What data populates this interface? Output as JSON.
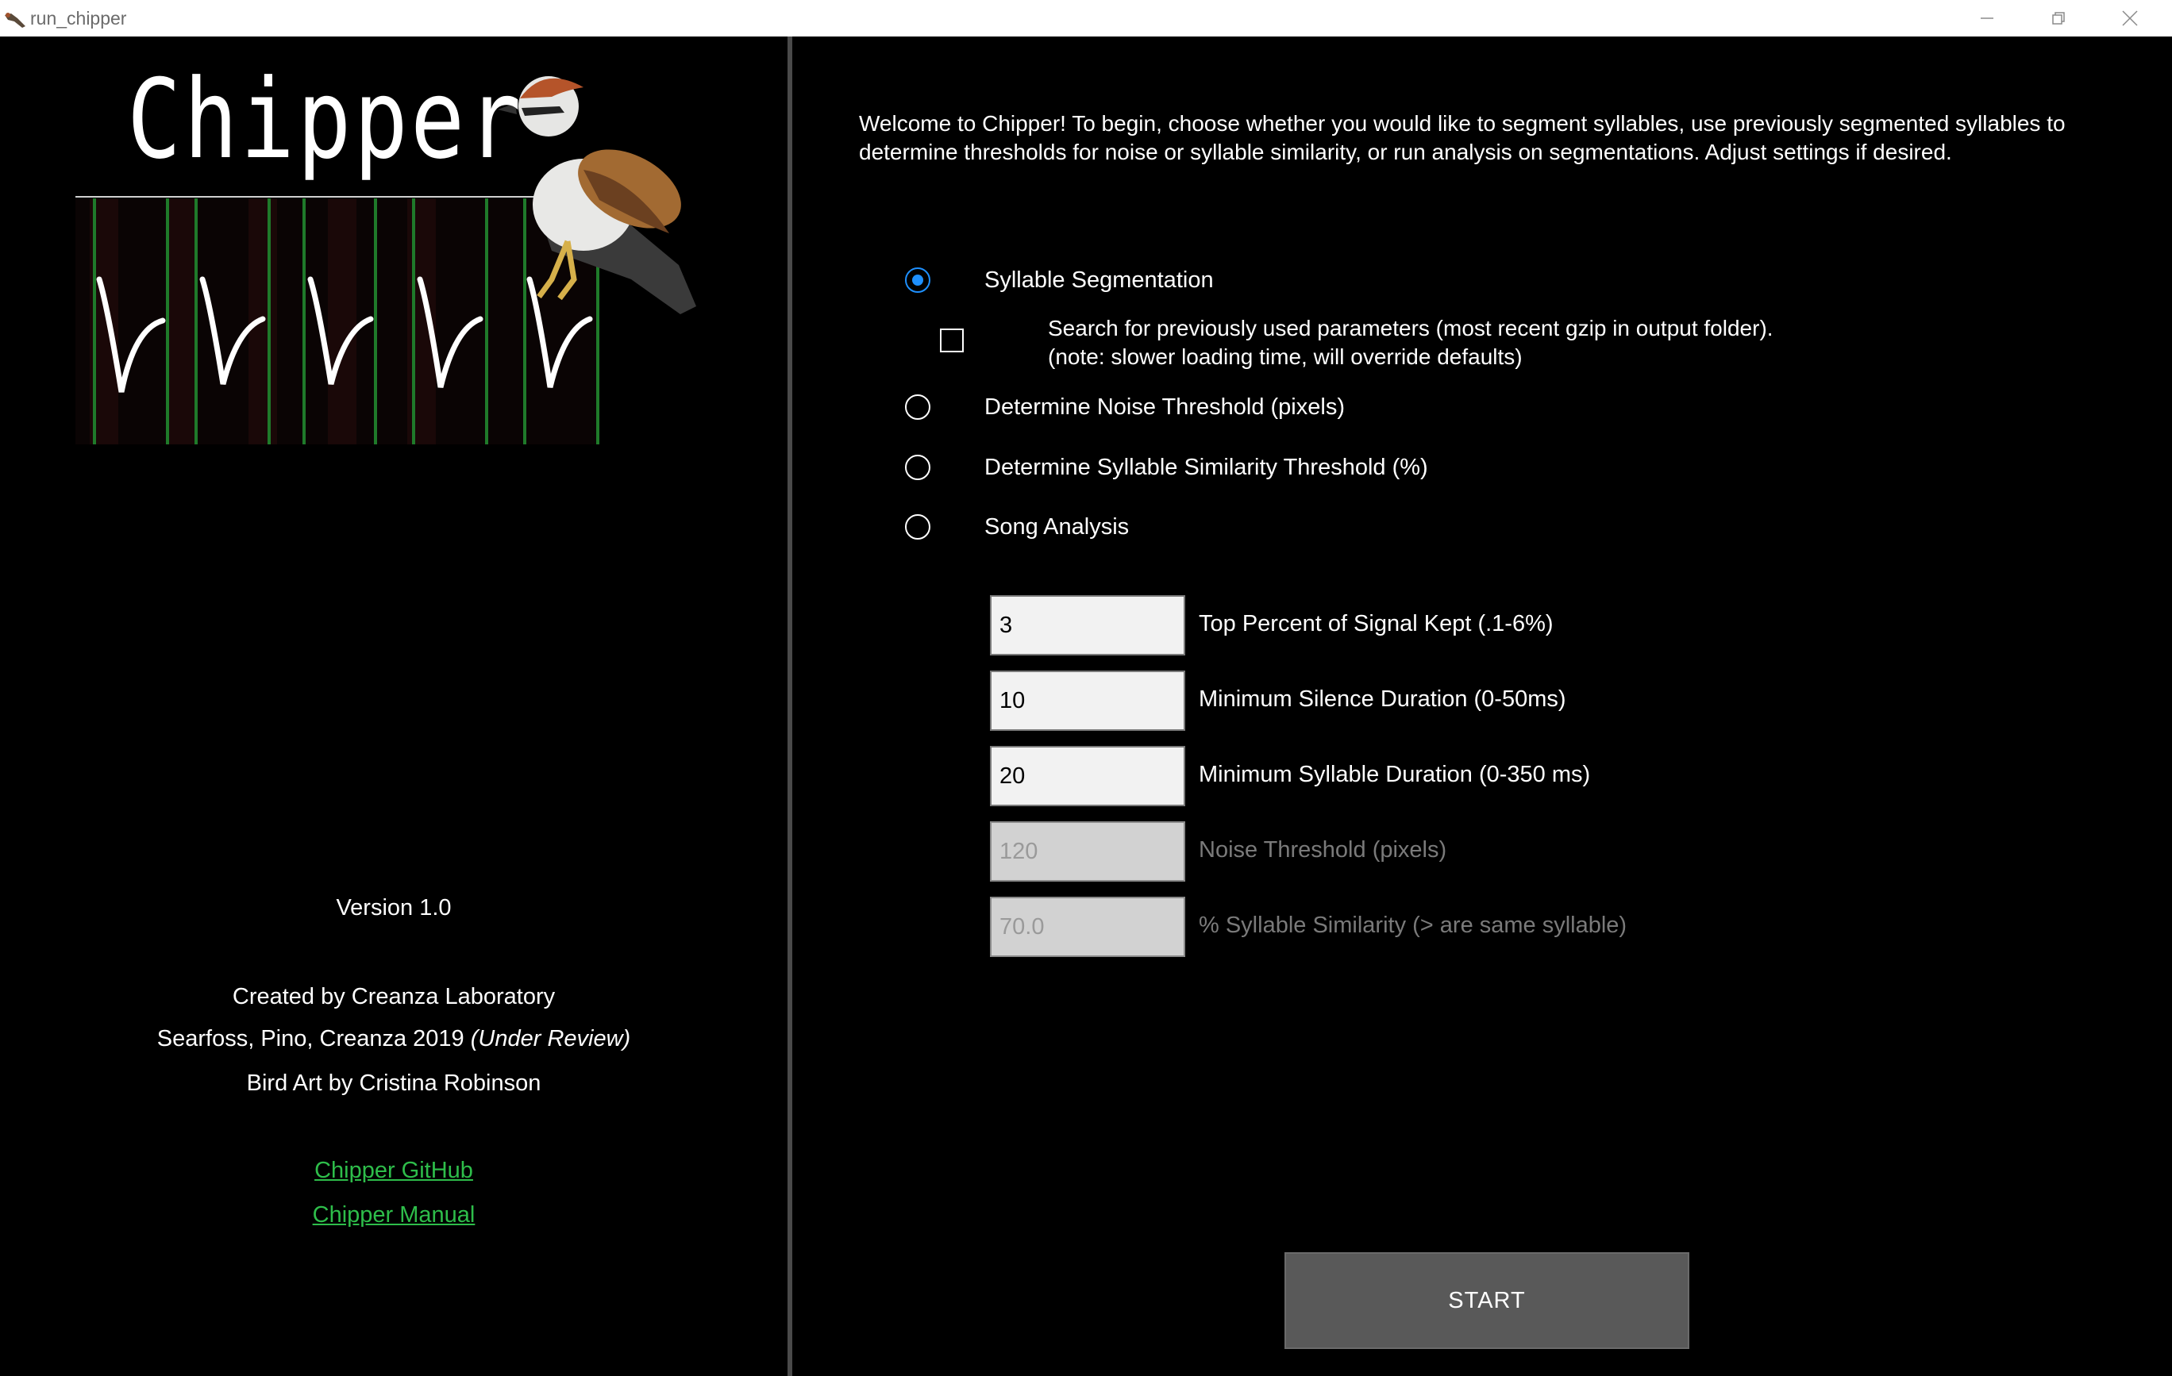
{
  "window": {
    "title": "run_chipper",
    "app_icon": "chipper-bird-icon",
    "controls": [
      "minimize-icon",
      "restore-icon",
      "close-icon"
    ]
  },
  "left": {
    "logo_text": "Chipper",
    "version": "Version 1.0",
    "created_by": "Created by Creanza Laboratory",
    "citation_text": "Searfoss, Pino, Creanza 2019 ",
    "citation_status": "(Under Review)",
    "bird_art": "Bird Art by Cristina Robinson",
    "links": {
      "github": "Chipper GitHub",
      "manual": "Chipper Manual"
    }
  },
  "right": {
    "welcome": "Welcome to Chipper! To begin, choose whether you would like to segment syllables, use previously segmented syllables to determine thresholds for noise or syllable similarity, or run analysis on segmentations. Adjust settings if desired.",
    "modes": [
      {
        "label": "Syllable Segmentation",
        "selected": true
      },
      {
        "label": "Determine Noise Threshold (pixels)",
        "selected": false
      },
      {
        "label": "Determine Syllable Similarity Threshold (%)",
        "selected": false
      },
      {
        "label": "Song Analysis",
        "selected": false
      }
    ],
    "search_params": {
      "checked": false,
      "line1": "Search for previously used parameters (most recent gzip in output folder).",
      "line2": "(note: slower loading time, will override defaults)"
    },
    "params": [
      {
        "value": "3",
        "label": "Top Percent of Signal Kept (.1-6%)",
        "enabled": true
      },
      {
        "value": "10",
        "label": "Minimum Silence Duration (0-50ms)",
        "enabled": true
      },
      {
        "value": "20",
        "label": "Minimum Syllable Duration (0-350 ms)",
        "enabled": true
      },
      {
        "value": "120",
        "label": "Noise Threshold (pixels)",
        "enabled": false
      },
      {
        "value": "70.0",
        "label": "% Syllable Similarity (> are same syllable)",
        "enabled": false
      }
    ],
    "start_label": "START"
  },
  "colors": {
    "background": "#000000",
    "link": "#2ebd4a",
    "radio_selected": "#1e90ff",
    "button": "#595959"
  }
}
